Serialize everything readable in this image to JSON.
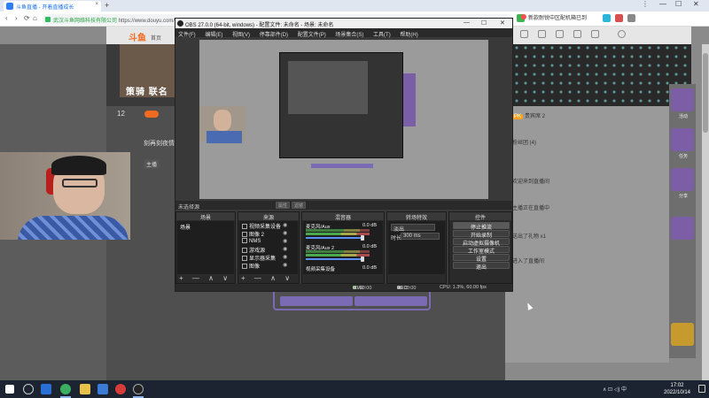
{
  "browser": {
    "tab_title": "斗鱼直播 - 开着直播成长",
    "tab_close": "×",
    "new_tab": "+",
    "win_controls": [
      "⋮",
      "—",
      "☐",
      "✕"
    ],
    "nav": [
      "‹",
      "›",
      "⟳",
      "⌂"
    ],
    "site_secure_label": "武汉斗鱼网络科技有限公司",
    "url": "https://www.douyu.com/...",
    "bookmark": "新款耐锐中区配机箱已到"
  },
  "site": {
    "logo": "斗鱼",
    "nav_first": "首页",
    "header_icons": [
      "",
      "",
      "",
      "",
      "",
      ""
    ],
    "banner_text": "策骑 联名",
    "stats_number": "12",
    "streamer_label": "刻再刻夜情",
    "streamer_badge": "主播",
    "right_rail": [
      "活动",
      "任务",
      "分享",
      "",
      ""
    ],
    "chat_lines": [
      {
        "tag": "PK",
        "text": "贵宾席 2"
      },
      {
        "tag": "",
        "text": "粉丝团 (4)"
      },
      {
        "tag": "",
        "text": "欢迎来到直播间"
      },
      {
        "tag": "",
        "text": "主播正在直播中"
      },
      {
        "tag": "",
        "text": "送出了礼物 x1"
      },
      {
        "tag": "",
        "text": "进入了直播间"
      }
    ]
  },
  "obs": {
    "title": "OBS 27.0.0 (64-bit, windows) - 配置文件: 未命名 - 场景: 未命名",
    "menu": [
      "文件(F)",
      "编辑(E)",
      "视图(V)",
      "停靠部件(D)",
      "配置文件(P)",
      "场景集合(S)",
      "工具(T)",
      "帮助(H)"
    ],
    "no_source": "未选择源",
    "studio_on": "属性",
    "studio_off": "滤镜",
    "docks": {
      "scenes": "场景",
      "sources": "来源",
      "mixer": "混音器",
      "transitions": "转场特效",
      "controls": "控件"
    },
    "scene_item": "场景",
    "sources_list": [
      "视频采集设备",
      "图像 2",
      "NMS",
      "游戏源",
      "显示器采集",
      "图像"
    ],
    "mixer_channels": [
      {
        "name": "麦克风/Aux",
        "db": "0.0 dB"
      },
      {
        "name": "麦克风/Aux 2",
        "db": "0.0 dB"
      },
      {
        "name": "视频采集设备",
        "db": "0.0 dB"
      }
    ],
    "transition_type": "淡出",
    "duration_label": "时长",
    "duration_value": "300 ms",
    "controls": [
      "停止推流",
      "开始录制",
      "启动虚拟摄像机",
      "工作室模式",
      "设置",
      "退出"
    ],
    "dock_footer": "+ — ∧ ∨",
    "status": {
      "live_label": "LIVE:",
      "live_time": "00:00:00",
      "rec_label": "REC:",
      "rec_time": "00:00:00",
      "cpu": "CPU: 1.3%, 60.00 fps"
    }
  },
  "taskbar": {
    "clock_time": "17:02",
    "clock_date": "2022/10/14",
    "tray": "∧  ⊡  ◁)  中"
  }
}
